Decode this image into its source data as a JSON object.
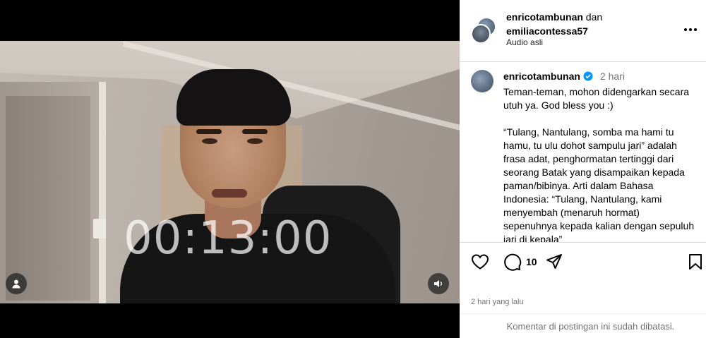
{
  "video": {
    "timer": "00:13:00",
    "profile_icon": "user-icon",
    "sound_icon": "speaker-icon"
  },
  "header": {
    "author1": "enricotambunan",
    "connector": "dan",
    "author2": "emiliacontessa57",
    "audio": "Audio asli",
    "more_icon": "more-options-icon"
  },
  "caption": {
    "username": "enricotambunan",
    "verified_icon": "verified-badge-icon",
    "time": "2 hari",
    "text": "Teman-teman, mohon didengarkan secara utuh ya. God bless you :)\n\n“Tulang, Nantulang, somba ma hami tu hamu, tu ulu dohot sampulu jari” adalah frasa adat, penghormatan tertinggi dari seorang Batak yang disampaikan kepada paman/bibinya. Arti dalam Bahasa Indonesia: “Tulang, Nantulang, kami menyembah (menaruh hormat) sepenuhnya kepada kalian dengan sepuluh jari di kepala”"
  },
  "actions": {
    "comment_count": "10",
    "posted": "2 hari yang lalu",
    "comments_disabled": "Komentar di postingan ini sudah dibatasi."
  },
  "colors": {
    "verified": "#0095f6",
    "muted_text": "#737373",
    "divider": "#dbdbdb"
  }
}
